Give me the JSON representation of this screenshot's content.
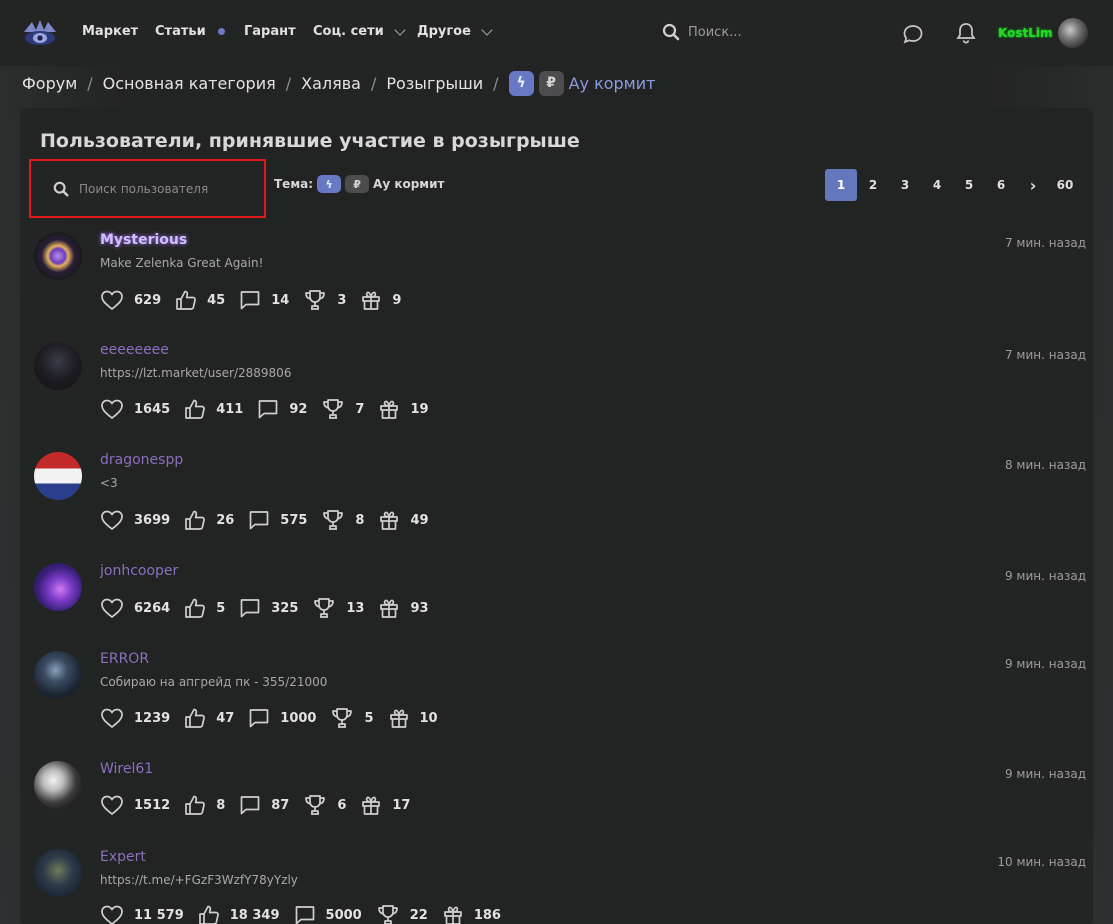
{
  "nav": {
    "items": [
      {
        "label": "Маркет"
      },
      {
        "label": "Статьи"
      },
      {
        "label": "Гарант"
      },
      {
        "label": "Соц. сети"
      },
      {
        "label": "Другое"
      }
    ],
    "search_placeholder": "Поиск...",
    "username": "KostLim"
  },
  "breadcrumb": {
    "items": [
      "Форум",
      "Основная категория",
      "Халява",
      "Розыгрыши"
    ],
    "current": "Ау кормит",
    "badge_bolt": "ϟ",
    "badge_rub": "₽"
  },
  "page": {
    "title": "Пользователи, принявшие участие в розыгрыше",
    "user_search_placeholder": "Поиск пользователя",
    "theme_label": "Тема:",
    "theme_name": "Ау кормит"
  },
  "pagination": {
    "pages": [
      "1",
      "2",
      "3",
      "4",
      "5",
      "6"
    ],
    "next": "›",
    "last": "60",
    "current": "1"
  },
  "participants": [
    {
      "name": "Mysterious",
      "status": "Make Zelenka Great Again!",
      "time": "7 мин. назад",
      "likes": "629",
      "thumbs": "45",
      "messages": "14",
      "trophies": "3",
      "gifts": "9"
    },
    {
      "name": "eeeeeeee",
      "status": "https://lzt.market/user/2889806",
      "time": "7 мин. назад",
      "likes": "1645",
      "thumbs": "411",
      "messages": "92",
      "trophies": "7",
      "gifts": "19"
    },
    {
      "name": "dragonespp",
      "status": "<3",
      "time": "8 мин. назад",
      "likes": "3699",
      "thumbs": "26",
      "messages": "575",
      "trophies": "8",
      "gifts": "49"
    },
    {
      "name": "jonhcooper",
      "status": "",
      "time": "9 мин. назад",
      "likes": "6264",
      "thumbs": "5",
      "messages": "325",
      "trophies": "13",
      "gifts": "93"
    },
    {
      "name": "ERROR",
      "status": "Собираю на апгрейд пк - 355/21000",
      "time": "9 мин. назад",
      "likes": "1239",
      "thumbs": "47",
      "messages": "1000",
      "trophies": "5",
      "gifts": "10"
    },
    {
      "name": "Wirel61",
      "status": "",
      "time": "9 мин. назад",
      "likes": "1512",
      "thumbs": "8",
      "messages": "87",
      "trophies": "6",
      "gifts": "17"
    },
    {
      "name": "Expert",
      "status": "https://t.me/+FGzF3WzfY78yYzly",
      "time": "10 мин. назад",
      "likes": "11 579",
      "thumbs": "18 349",
      "messages": "5000",
      "trophies": "22",
      "gifts": "186"
    }
  ],
  "colors": {
    "accent": "#6477bd",
    "username_online": "#29d62d",
    "highlight_border": "#e01a1a",
    "participant_name": "#8c6fbd"
  }
}
